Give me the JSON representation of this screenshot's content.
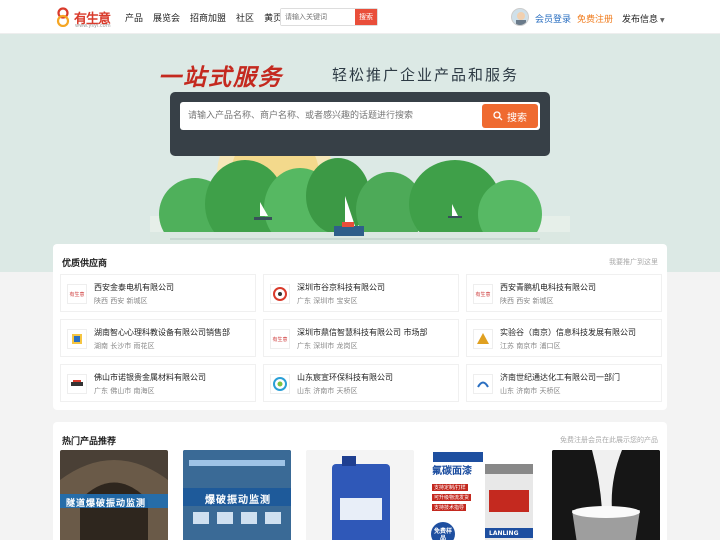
{
  "header": {
    "logo_text": "有生意",
    "logo_sub": "www.ysyi.com",
    "nav": [
      "产品",
      "展览会",
      "招商加盟",
      "社区",
      "黄页"
    ],
    "search_placeholder": "请输入关键词",
    "search_button": "搜索",
    "login": "会员登录",
    "register": "免费注册",
    "publish": "发布信息"
  },
  "banner": {
    "slogan_main": "一站式服务",
    "slogan_sub": "轻松推广企业产品和服务",
    "search_placeholder": "请输入产品名称、商户名称、或者感兴趣的话题进行搜索",
    "search_button": "搜索"
  },
  "suppliers": {
    "title": "优质供应商",
    "right_link": "我要推广到这里",
    "items": [
      {
        "name": "西安金泰电机有限公司",
        "loc": "陕西 西安 新城区",
        "logo": "有生意"
      },
      {
        "name": "深圳市谷京科技有限公司",
        "loc": "广东 深圳市 宝安区",
        "logo": ""
      },
      {
        "name": "西安青鹏机电科技有限公司",
        "loc": "陕西 西安 新城区",
        "logo": "有生意"
      },
      {
        "name": "湖南智心心理科教设备有限公司销售部",
        "loc": "湖南 长沙市 雨花区",
        "logo": ""
      },
      {
        "name": "深圳市鼎信智慧科技有限公司 市场部",
        "loc": "广东 深圳市 龙岗区",
        "logo": "有生意"
      },
      {
        "name": "实验谷（南京）信息科技发展有限公司",
        "loc": "江苏 南京市 浦口区",
        "logo": ""
      },
      {
        "name": "佛山市诺银贵金属材料有限公司",
        "loc": "广东 佛山市 南海区",
        "logo": ""
      },
      {
        "name": "山东宸宣环保科技有限公司",
        "loc": "山东 济南市 天桥区",
        "logo": ""
      },
      {
        "name": "济南世纪通达化工有限公司一部门",
        "loc": "山东 济南市 天桥区",
        "logo": ""
      }
    ]
  },
  "products": {
    "title": "热门产品推荐",
    "right_link": "免费注册会员在此展示您的产品",
    "items": [
      {
        "caption": "隧道爆破振动监测"
      },
      {
        "caption": "爆破振动监测"
      },
      {
        "caption": ""
      },
      {
        "caption": "氟碳面漆"
      },
      {
        "caption": ""
      }
    ],
    "p4_tags": [
      "支持定制/打样",
      "可升级物流发货",
      "支持技术指导"
    ],
    "p4_badge": "免费样品",
    "p4_brand": "LANLING"
  },
  "colors": {
    "brand_red": "#d93a2b",
    "accent_orange": "#ef6a30",
    "link_blue": "#2a6fc1"
  }
}
